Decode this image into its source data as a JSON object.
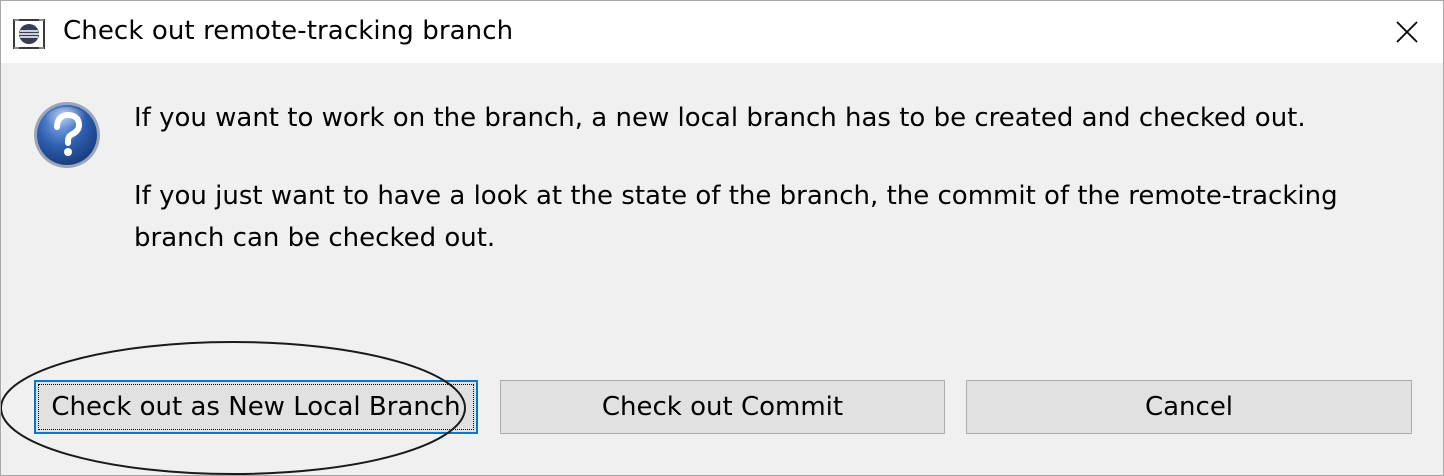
{
  "window": {
    "title": "Check out remote-tracking branch",
    "app_icon": "eclipse-icon",
    "close_icon": "close-icon"
  },
  "message": {
    "icon": "question-icon",
    "line1": "If you want to work on the branch, a new local branch has to be created and checked out.",
    "line2": "If you just want to have a look at the state of the branch, the commit of the remote-tracking",
    "line3": "branch can be checked out."
  },
  "buttons": {
    "new_local_branch": "Check out as New Local Branch",
    "commit": "Check out Commit",
    "cancel": "Cancel"
  },
  "colors": {
    "dialog_bg": "#f0f0f0",
    "button_bg": "#e1e1e1",
    "focus_border": "#0078d7",
    "icon_blue": "#2e5fb0"
  }
}
